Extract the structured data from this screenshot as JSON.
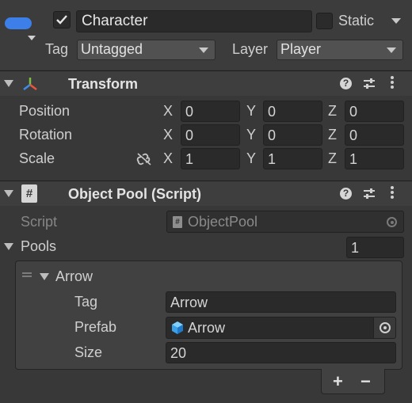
{
  "gameobject": {
    "active_checked": true,
    "name": "Character",
    "static_label": "Static",
    "static_checked": false,
    "tag_label": "Tag",
    "tag_value": "Untagged",
    "layer_label": "Layer",
    "layer_value": "Player",
    "icon": "cube-icon-blue"
  },
  "transform": {
    "title": "Transform",
    "rows": [
      {
        "label": "Position",
        "x": "0",
        "y": "0",
        "z": "0"
      },
      {
        "label": "Rotation",
        "x": "0",
        "y": "0",
        "z": "0"
      },
      {
        "label": "Scale",
        "x": "1",
        "y": "1",
        "z": "1"
      }
    ],
    "axis_x": "X",
    "axis_y": "Y",
    "axis_z": "Z"
  },
  "object_pool": {
    "title": "Object Pool (Script)",
    "script_label": "Script",
    "script_value": "ObjectPool",
    "pools_label": "Pools",
    "pools_count": "1",
    "element": {
      "name": "Arrow",
      "tag_label": "Tag",
      "tag_value": "Arrow",
      "prefab_label": "Prefab",
      "prefab_value": "Arrow",
      "size_label": "Size",
      "size_value": "20"
    },
    "add_label": "+",
    "remove_label": "−"
  },
  "colors": {
    "background": "#383838",
    "header": "#3e3e3e",
    "field": "#2a2a2a",
    "transform_x": "#e8543c",
    "transform_y": "#7ac143",
    "transform_z": "#3d8de8",
    "cube_blue": "#3aa0e8",
    "gameobject_icon": "#3d7fe8"
  }
}
